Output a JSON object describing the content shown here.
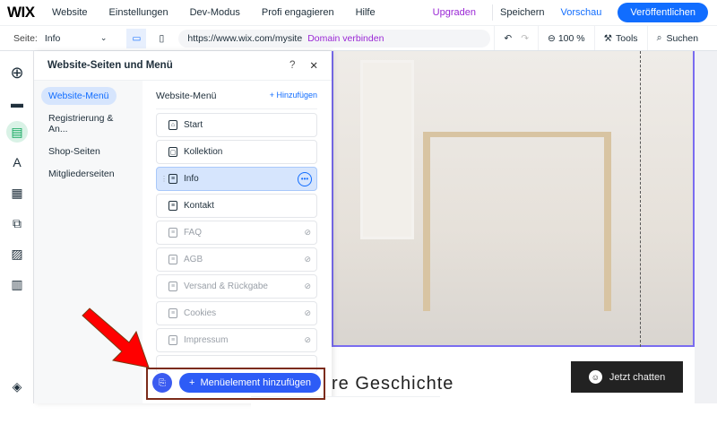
{
  "topbar": {
    "logo": "WIX",
    "nav": [
      "Website",
      "Einstellungen",
      "Dev-Modus",
      "Profi engagieren",
      "Hilfe"
    ],
    "upgrade": "Upgraden",
    "save": "Speichern",
    "preview": "Vorschau",
    "publish": "Veröffentlichen"
  },
  "toolbar": {
    "page_label": "Seite:",
    "page_value": "Info",
    "url": "https://www.wix.com/mysite",
    "connect_domain": "Domain verbinden",
    "zoom": "100 %",
    "tools": "Tools",
    "search": "Suchen"
  },
  "panel": {
    "title": "Website-Seiten und Menü",
    "help": "?",
    "close": "✕",
    "categories": [
      "Website-Menü",
      "Registrierung & An...",
      "Shop-Seiten",
      "Mitgliederseiten"
    ],
    "list_title": "Website-Menü",
    "add_label": "+ Hinzufügen",
    "pages": [
      {
        "name": "Start",
        "icon": "home-icon",
        "hidden": false
      },
      {
        "name": "Kollektion",
        "icon": "bag-icon",
        "hidden": false
      },
      {
        "name": "Info",
        "icon": "page-icon",
        "hidden": false,
        "selected": true
      },
      {
        "name": "Kontakt",
        "icon": "page-icon",
        "hidden": false
      },
      {
        "name": "FAQ",
        "icon": "page-icon",
        "hidden": true
      },
      {
        "name": "AGB",
        "icon": "page-icon",
        "hidden": true
      },
      {
        "name": "Versand & Rückgabe",
        "icon": "page-icon",
        "hidden": true
      },
      {
        "name": "Cookies",
        "icon": "page-icon",
        "hidden": true
      },
      {
        "name": "Impressum",
        "icon": "page-icon",
        "hidden": true
      }
    ],
    "add_menu_item": "Menüelement hinzufügen"
  },
  "site": {
    "heading": "re Geschichte",
    "chat": "Jetzt chatten"
  }
}
